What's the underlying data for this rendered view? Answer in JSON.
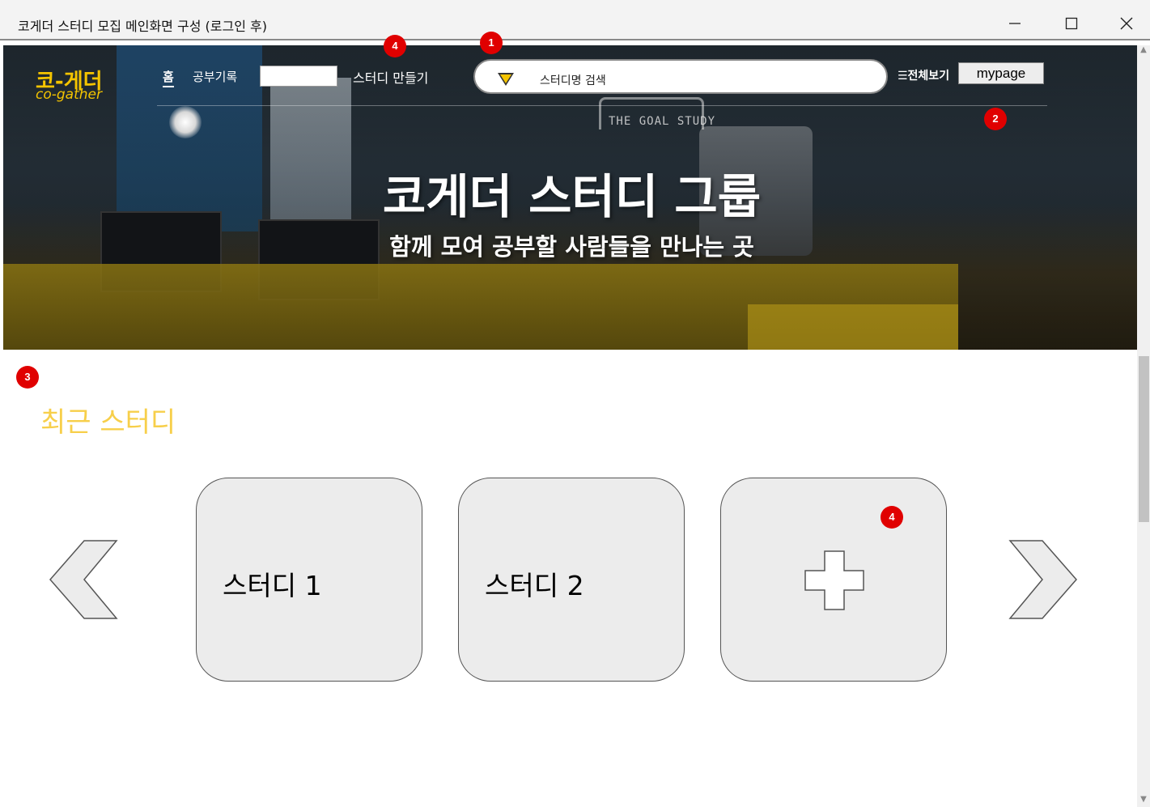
{
  "window": {
    "title": "코게더 스터디 모집 메인화면 구성 (로그인 후)"
  },
  "header": {
    "logo_ko": "코-게더",
    "logo_en": "co-gather",
    "nav_home": "홈",
    "nav_record": "공부기록",
    "nav_create": "스터디 만들기",
    "search_placeholder": "스터디명 검색",
    "view_all": "☰전체보기",
    "mypage": "mypage"
  },
  "hero": {
    "sign_text": "THE GOAL STUDY",
    "title": "코게더 스터디 그룹",
    "subtitle": "함께 모여 공부할 사람들을 만나는 곳"
  },
  "badges": {
    "search": "1",
    "mypage": "2",
    "recent": "3",
    "create": "4",
    "add_card": "4"
  },
  "recent": {
    "title": "최근 스터디",
    "cards": [
      {
        "label": "스터디 1"
      },
      {
        "label": "스터디 2"
      }
    ]
  },
  "colors": {
    "accent": "#f4c400",
    "section_title": "#f7cf4a",
    "badge": "#e00000",
    "card_bg": "#ececec"
  },
  "icons": {
    "prev": "chevron-left-icon",
    "next": "chevron-right-icon",
    "add": "plus-icon",
    "search_dropdown": "triangle-down-icon"
  }
}
